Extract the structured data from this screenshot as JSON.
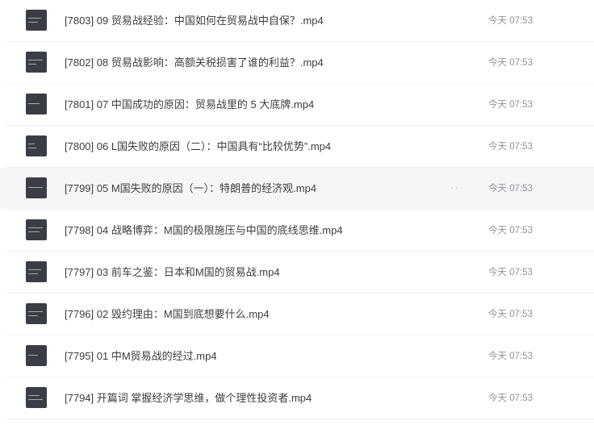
{
  "files": [
    {
      "title": "[7803] 09 贸易战经验：中国如何在贸易战中自保？.mp4",
      "time": "今天 07:53",
      "thumb_icon": "video-thumbnail-icon"
    },
    {
      "title": "[7802] 08 贸易战影响：高额关税损害了谁的利益？.mp4",
      "time": "今天 07:53",
      "thumb_icon": "video-thumbnail-icon"
    },
    {
      "title": "[7801] 07 中国成功的原因：贸易战里的 5 大底牌.mp4",
      "time": "今天 07:53",
      "thumb_icon": "video-thumbnail-icon"
    },
    {
      "title": "[7800] 06 L国失败的原因（二）：中国具有“比较优势”.mp4",
      "time": "今天 07:53",
      "thumb_icon": "video-thumbnail-icon"
    },
    {
      "title": "[7799] 05 M国失败的原因（一）：特朗普的经济观.mp4",
      "time": "今天 07:53",
      "thumb_icon": "video-thumbnail-icon",
      "hovered": true,
      "more_label": "···"
    },
    {
      "title": "[7798] 04 战略博弈：M国的极限施压与中国的底线思维.mp4",
      "time": "今天 07:53",
      "thumb_icon": "video-thumbnail-icon"
    },
    {
      "title": "[7797] 03 前车之鉴：日本和M国的贸易战.mp4",
      "time": "今天 07:53",
      "thumb_icon": "video-thumbnail-icon"
    },
    {
      "title": "[7796] 02 毁约理由：M国到底想要什么.mp4",
      "time": "今天 07:53",
      "thumb_icon": "video-thumbnail-icon"
    },
    {
      "title": "[7795] 01 中M贸易战的经过.mp4",
      "time": "今天 07:53",
      "thumb_icon": "video-thumbnail-icon"
    },
    {
      "title": "[7794] 开篇词 掌握经济学思维，做个理性投资者.mp4",
      "time": "今天 07:53",
      "thumb_icon": "video-thumbnail-icon"
    }
  ],
  "colors": {
    "thumbnail_bg": "#3a3d45",
    "hover_row_bg": "#f5f6f8",
    "title_text": "#3d3d3d",
    "time_text": "#8e9199"
  }
}
